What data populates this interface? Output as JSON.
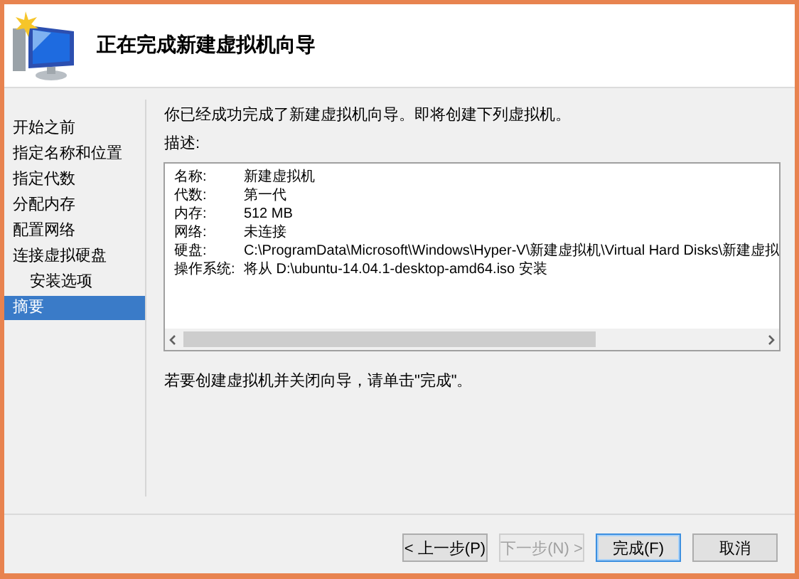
{
  "header": {
    "title": "正在完成新建虚拟机向导"
  },
  "sidebar": {
    "items": [
      {
        "label": "开始之前",
        "selected": false
      },
      {
        "label": "指定名称和位置",
        "selected": false
      },
      {
        "label": "指定代数",
        "selected": false
      },
      {
        "label": "分配内存",
        "selected": false
      },
      {
        "label": "配置网络",
        "selected": false
      },
      {
        "label": "连接虚拟硬盘",
        "selected": false,
        "children": [
          {
            "label": "安装选项",
            "selected": false
          }
        ]
      },
      {
        "label": "摘要",
        "selected": true
      }
    ]
  },
  "content": {
    "intro": "你已经成功完成了新建虚拟机向导。即将创建下列虚拟机。",
    "description_label": "描述:",
    "summary": [
      {
        "name": "名称:",
        "value": "新建虚拟机"
      },
      {
        "name": "代数:",
        "value": "第一代"
      },
      {
        "name": "内存:",
        "value": "512 MB"
      },
      {
        "name": "网络:",
        "value": "未连接"
      },
      {
        "name": "硬盘:",
        "value": "C:\\ProgramData\\Microsoft\\Windows\\Hyper-V\\新建虚拟机\\Virtual Hard Disks\\新建虚拟"
      },
      {
        "name": "操作系统:",
        "value": "将从 D:\\ubuntu-14.04.1-desktop-amd64.iso 安装"
      }
    ],
    "hint": "若要创建虚拟机并关闭向导，请单击\"完成\"。"
  },
  "buttons": [
    {
      "label": "< 上一步(P)",
      "disabled": false,
      "default": false
    },
    {
      "label": "下一步(N) >",
      "disabled": true,
      "default": false
    },
    {
      "label": "完成(F)",
      "disabled": false,
      "default": true
    },
    {
      "label": "取消",
      "disabled": false,
      "default": false
    }
  ]
}
